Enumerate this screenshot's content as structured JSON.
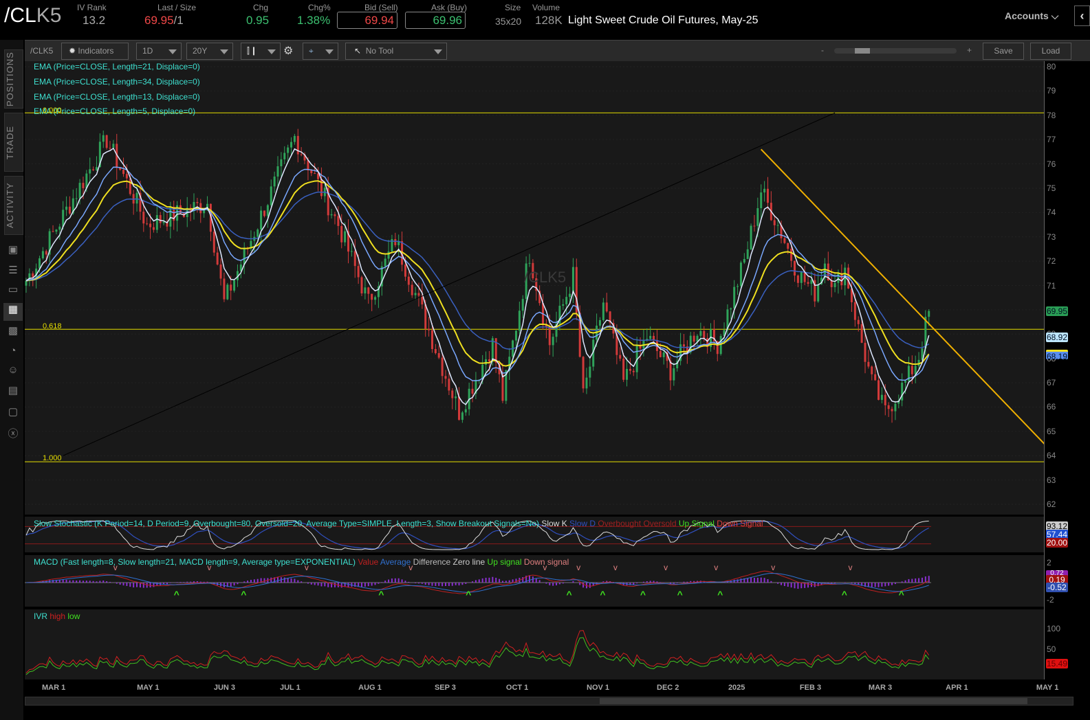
{
  "header": {
    "symbol_a": "/CL",
    "symbol_b": "K5",
    "iv_rank_label": "IV Rank",
    "iv_rank": "13.2",
    "last_label": "Last / Size",
    "last": "69.95",
    "size": "/1",
    "chg_label": "Chg",
    "chg": "0.95",
    "chgp_label": "Chg%",
    "chgp": "1.38%",
    "bid_label": "Bid (Sell)",
    "bid": "69.94",
    "ask_label": "Ask (Buy)",
    "ask": "69.96",
    "sz_label": "Size",
    "sz": "35x20",
    "vol_label": "Volume",
    "vol": "128K",
    "description": "Light Sweet Crude Oil Futures, May-25",
    "accounts": "Accounts"
  },
  "toolbar": {
    "symbol": "/CLK5",
    "indicators": "Indicators",
    "aggregation": "1D",
    "range": "20Y",
    "tool": "No Tool",
    "zoom_minus": "-",
    "zoom_plus": "+",
    "save": "Save",
    "load": "Load"
  },
  "sidebar": {
    "tabs": [
      "POSITIONS",
      "TRADE",
      "ACTIVITY"
    ]
  },
  "studies": {
    "ema21": "EMA (Price=CLOSE, Length=21, Displace=0)",
    "ema34": "EMA (Price=CLOSE, Length=34, Displace=0)",
    "ema13": "EMA (Price=CLOSE, Length=13, Displace=0)",
    "ema5": "EMA (Price=CLOSE, Length=5, Displace=0)",
    "watermark": "/CLK5"
  },
  "fib": {
    "l0": "0.000",
    "l618": "0.618",
    "l1": "1.000"
  },
  "stoch": {
    "label": "Slow Stochastic (K Period=14, D Period=9, Overbought=80, Oversold=20, Average Type=SIMPLE, Length=3, Show Breakout Signals=No)",
    "k": "Slow K",
    "d": "Slow D",
    "ob": "Overbought",
    "os": "Oversold",
    "up": "Up Signal",
    "down": "Down Signal",
    "tag_k": "93.12",
    "tag_d": "57.44",
    "tag_os": "20.00"
  },
  "macd": {
    "label": "MACD (Fast length=8, Slow length=21, MACD length=9, Average type=EXPONENTIAL)",
    "value": "Value",
    "avg": "Average",
    "diff": "Difference",
    "zero": "Zero line",
    "up": "Up signal",
    "down": "Down signal",
    "tick_hi": "2",
    "tick_lo": "-2",
    "tag_v": "0.72",
    "tag_d": "0.19",
    "tag_a": "-0.52"
  },
  "ivr": {
    "label": "IVR",
    "high": "high",
    "low": "low",
    "tick100": "100",
    "tick50": "50",
    "tag": "15.49"
  },
  "price_tags": {
    "last": "69.95",
    "ema_a": "68.92",
    "ema_b": "68.19"
  },
  "colors": {
    "up": "#2fa35a",
    "down": "#d23a3a",
    "ema5": "#dfe8ff",
    "ema13": "#7aa8ff",
    "ema21": "#f0e020",
    "ema34": "#3a60c0",
    "fib": "#e8e000",
    "trend": "#f0b000"
  },
  "chart_data": {
    "type": "candlestick",
    "title": "/CLK5 Daily",
    "ylim": [
      62,
      80
    ],
    "yticks": [
      62,
      63,
      64,
      65,
      66,
      67,
      68,
      69,
      70,
      71,
      72,
      73,
      74,
      75,
      76,
      77,
      78,
      79,
      80
    ],
    "xticks": [
      {
        "label": "MAR 1",
        "x": 8.4
      },
      {
        "label": "MAY 1",
        "x": 36.7
      },
      {
        "label": "JUN 3",
        "x": 59.6
      },
      {
        "label": "JUL 1",
        "x": 79.3
      },
      {
        "label": "AUG 1",
        "x": 102.7
      },
      {
        "label": "SEP 3",
        "x": 125.4
      },
      {
        "label": "OCT 1",
        "x": 146.7
      },
      {
        "label": "NOV 1",
        "x": 170.7
      },
      {
        "label": "DEC 2",
        "x": 191.6
      },
      {
        "label": "2025",
        "x": 212.9
      },
      {
        "label": "FEB 3",
        "x": 234.2
      },
      {
        "label": "MAR 3",
        "x": 254.7
      },
      {
        "label": "APR 1",
        "x": 277.7
      },
      {
        "label": "MAY 1",
        "x": 304.7
      }
    ],
    "close_keypoints": [
      [
        0,
        71.2
      ],
      [
        24,
        77.0
      ],
      [
        36,
        73.5
      ],
      [
        54,
        74.4
      ],
      [
        59,
        70.3
      ],
      [
        80,
        77.1
      ],
      [
        93,
        73.5
      ],
      [
        102,
        70.3
      ],
      [
        110,
        72.9
      ],
      [
        129,
        65.8
      ],
      [
        139,
        68.6
      ],
      [
        142,
        66.4
      ],
      [
        150,
        72.3
      ],
      [
        156,
        68.6
      ],
      [
        163,
        71.4
      ],
      [
        166,
        66.4
      ],
      [
        172,
        70.3
      ],
      [
        178,
        67.0
      ],
      [
        185,
        68.9
      ],
      [
        192,
        67.5
      ],
      [
        200,
        69.2
      ],
      [
        206,
        68.6
      ],
      [
        214,
        72.0
      ],
      [
        219,
        74.9
      ],
      [
        224,
        73.5
      ],
      [
        230,
        71.5
      ],
      [
        235,
        70.7
      ],
      [
        238,
        72.0
      ],
      [
        241,
        70.9
      ],
      [
        244,
        71.7
      ],
      [
        248,
        69.2
      ],
      [
        252,
        67.0
      ],
      [
        256,
        65.8
      ],
      [
        262,
        67.0
      ],
      [
        266,
        68.1
      ],
      [
        269,
        69.95
      ]
    ],
    "fib_levels": [
      78.1,
      69.2,
      63.75
    ],
    "trendlines": [
      {
        "from": [
          11,
          64.0
        ],
        "to": [
          241,
          78.1
        ],
        "color": "black"
      },
      {
        "from": [
          219,
          76.6
        ],
        "to": [
          304,
          64.4
        ],
        "color": "orange"
      }
    ],
    "ema_lengths": [
      5,
      13,
      21,
      34
    ]
  }
}
